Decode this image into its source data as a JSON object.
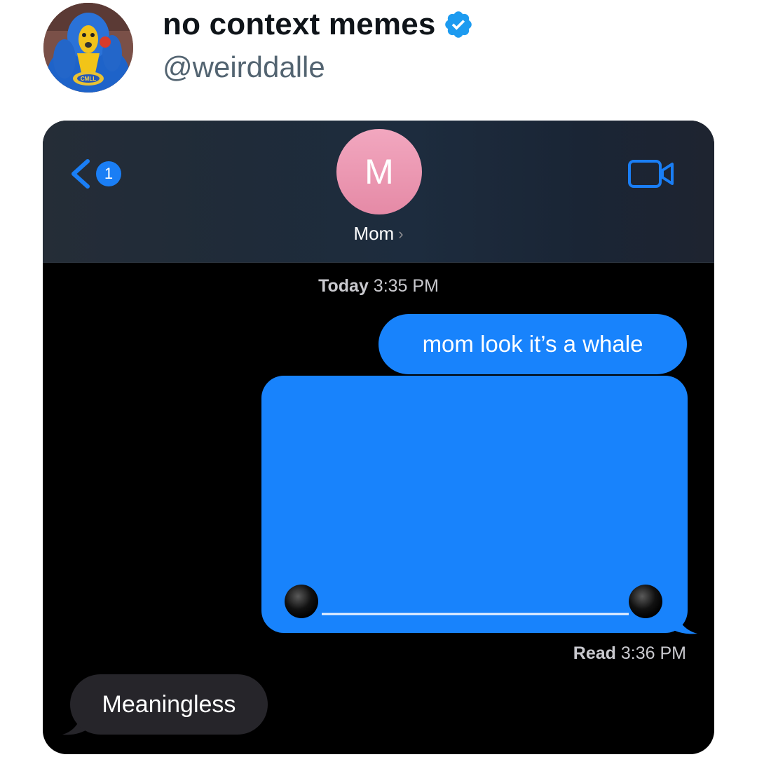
{
  "tweet": {
    "author_name": "no context memes",
    "handle": "@weirddalle",
    "verified": true,
    "verified_color": "#1d9bf0",
    "avatar_icon": "gorilla-mascot-avatar",
    "avatar_badge_text": "CMLL"
  },
  "conversation_header": {
    "back_icon": "chevron-left-icon",
    "unread_count": "1",
    "contact_initial": "M",
    "contact_name": "Mom",
    "contact_chevron": "›",
    "video_icon": "video-camera-icon"
  },
  "messages": {
    "timestamp_day": "Today",
    "timestamp_time": "3:35 PM",
    "sent_text": "mom look it’s a whale",
    "sent_image_description_icon": "whale-drawing",
    "read_label": "Read",
    "read_time": "3:36 PM",
    "received_text": "Meaningless"
  },
  "colors": {
    "sent_bubble": "#1883fc",
    "received_bubble": "#26252a",
    "contact_avatar": "#ec98b3",
    "accent_blue": "#1a7ef5"
  }
}
